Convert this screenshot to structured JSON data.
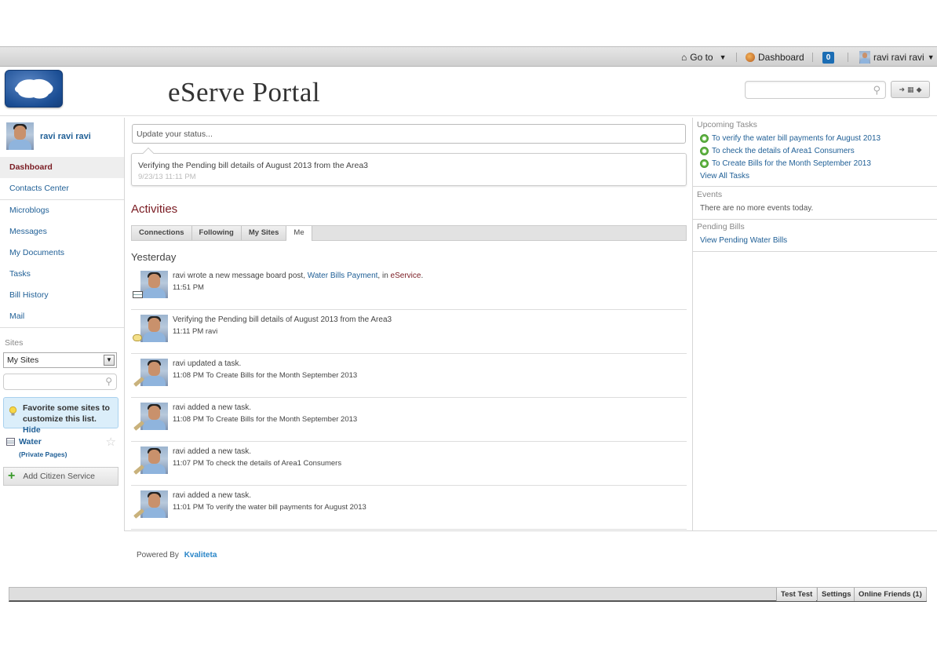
{
  "dockbar": {
    "goto_label": "Go to",
    "dashboard_label": "Dashboard",
    "notification_count": "0",
    "user_label": "ravi ravi ravi"
  },
  "header": {
    "site_title": "eServe Portal",
    "search_placeholder": ""
  },
  "sidebar": {
    "user_name": "ravi ravi ravi",
    "items": [
      {
        "label": "Dashboard"
      },
      {
        "label": "Contacts Center"
      },
      {
        "label": "Microblogs"
      },
      {
        "label": "Messages"
      },
      {
        "label": "My Documents"
      },
      {
        "label": "Tasks"
      },
      {
        "label": "Bill History"
      },
      {
        "label": "Mail"
      }
    ],
    "sites_label": "Sites",
    "sites_select_value": "My Sites",
    "tip_text": "Favorite some sites to customize this list.",
    "tip_hide": "Hide",
    "site_name": "Water",
    "site_sub": "(Private Pages)",
    "add_button": "Add Citizen Service"
  },
  "main": {
    "status_placeholder": "Update your status...",
    "current_status": "Verifying the Pending bill details of August 2013 from the Area3",
    "current_status_time": "9/23/13 11:11 PM",
    "activities_title": "Activities",
    "tabs": [
      {
        "label": "Connections"
      },
      {
        "label": "Following"
      },
      {
        "label": "My Sites"
      },
      {
        "label": "Me"
      }
    ],
    "day_heading": "Yesterday",
    "feed": [
      {
        "pre": "ravi wrote a new message board post, ",
        "link": "Water Bills Payment",
        "mid": ", in ",
        "link2": "eService",
        "post": ".",
        "meta": "11:51 PM"
      },
      {
        "text": "Verifying the Pending bill details of August 2013 from the Area3",
        "meta": "11:11 PM ravi"
      },
      {
        "text": "ravi updated a task.",
        "meta": "11:08 PM To Create Bills for the Month September 2013"
      },
      {
        "text": "ravi added a new task.",
        "meta": "11:08 PM To Create Bills for the Month September 2013"
      },
      {
        "text": "ravi added a new task.",
        "meta": "11:07 PM To check the details of Area1 Consumers"
      },
      {
        "text": "ravi added a new task.",
        "meta": "11:01 PM To verify the water bill payments for August 2013"
      }
    ]
  },
  "right": {
    "tasks_title": "Upcoming Tasks",
    "tasks": [
      {
        "label": "To verify the water bill payments for August 2013"
      },
      {
        "label": "To check the details of Area1 Consumers"
      },
      {
        "label": "To Create Bills for the Month September 2013"
      }
    ],
    "view_all": "View All Tasks",
    "events_title": "Events",
    "events_text": "There are no more events today.",
    "bills_title": "Pending Bills",
    "bills_link": "View Pending Water Bills"
  },
  "footer": {
    "powered_by": "Powered By",
    "brand": "Kvaliteta",
    "chat_buttons": [
      {
        "label": "Test Test"
      },
      {
        "label": "Settings"
      },
      {
        "label": "Online Friends (1)"
      }
    ]
  },
  "colors": {
    "accent_red": "#7a1b22",
    "link_blue": "#1f5f96",
    "badge_blue": "#1b6db4",
    "task_green": "#6cc04a"
  }
}
